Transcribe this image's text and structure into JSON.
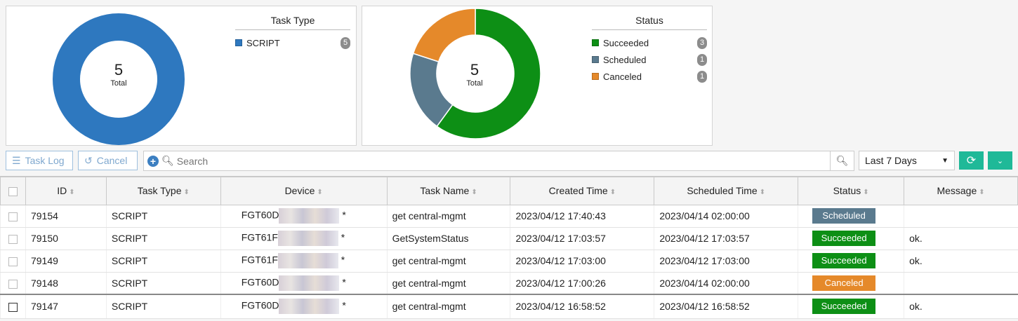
{
  "task_type_chart": {
    "title": "Task Type",
    "total": "5",
    "total_label": "Total",
    "items": [
      {
        "label": "SCRIPT",
        "count": "5",
        "value": 5,
        "color": "#2e78bf"
      }
    ]
  },
  "status_chart": {
    "title": "Status",
    "total": "5",
    "total_label": "Total",
    "items": [
      {
        "label": "Succeeded",
        "count": "3",
        "value": 3,
        "color": "#0d8f15"
      },
      {
        "label": "Scheduled",
        "count": "1",
        "value": 1,
        "color": "#5a7a8e"
      },
      {
        "label": "Canceled",
        "count": "1",
        "value": 1,
        "color": "#e5892a"
      }
    ]
  },
  "toolbar": {
    "task_log": "Task Log",
    "cancel": "Cancel",
    "search_placeholder": "Search",
    "range": "Last 7 Days"
  },
  "columns": [
    "ID",
    "Task Type",
    "Device",
    "Task Name",
    "Created Time",
    "Scheduled Time",
    "Status",
    "Message"
  ],
  "rows": [
    {
      "id": "79154",
      "type": "SCRIPT",
      "device": "FGT60D",
      "suffix": "*",
      "task": "get central-mgmt",
      "created": "2023/04/12 17:40:43",
      "scheduled": "2023/04/14 02:00:00",
      "status": "Scheduled",
      "color": "#5a7a8e",
      "message": ""
    },
    {
      "id": "79150",
      "type": "SCRIPT",
      "device": "FGT61F",
      "suffix": "*",
      "task": "GetSystemStatus",
      "created": "2023/04/12 17:03:57",
      "scheduled": "2023/04/12 17:03:57",
      "status": "Succeeded",
      "color": "#0d8f15",
      "message": "ok."
    },
    {
      "id": "79149",
      "type": "SCRIPT",
      "device": "FGT61F",
      "suffix": "*",
      "task": "get central-mgmt",
      "created": "2023/04/12 17:03:00",
      "scheduled": "2023/04/12 17:03:00",
      "status": "Succeeded",
      "color": "#0d8f15",
      "message": "ok."
    },
    {
      "id": "79148",
      "type": "SCRIPT",
      "device": "FGT60D",
      "suffix": "*",
      "task": "get central-mgmt",
      "created": "2023/04/12 17:00:26",
      "scheduled": "2023/04/14 02:00:00",
      "status": "Canceled",
      "color": "#e5892a",
      "message": ""
    },
    {
      "id": "79147",
      "type": "SCRIPT",
      "device": "FGT60D",
      "suffix": "*",
      "task": "get central-mgmt",
      "created": "2023/04/12 16:58:52",
      "scheduled": "2023/04/12 16:58:52",
      "status": "Succeeded",
      "color": "#0d8f15",
      "message": "ok."
    }
  ]
}
